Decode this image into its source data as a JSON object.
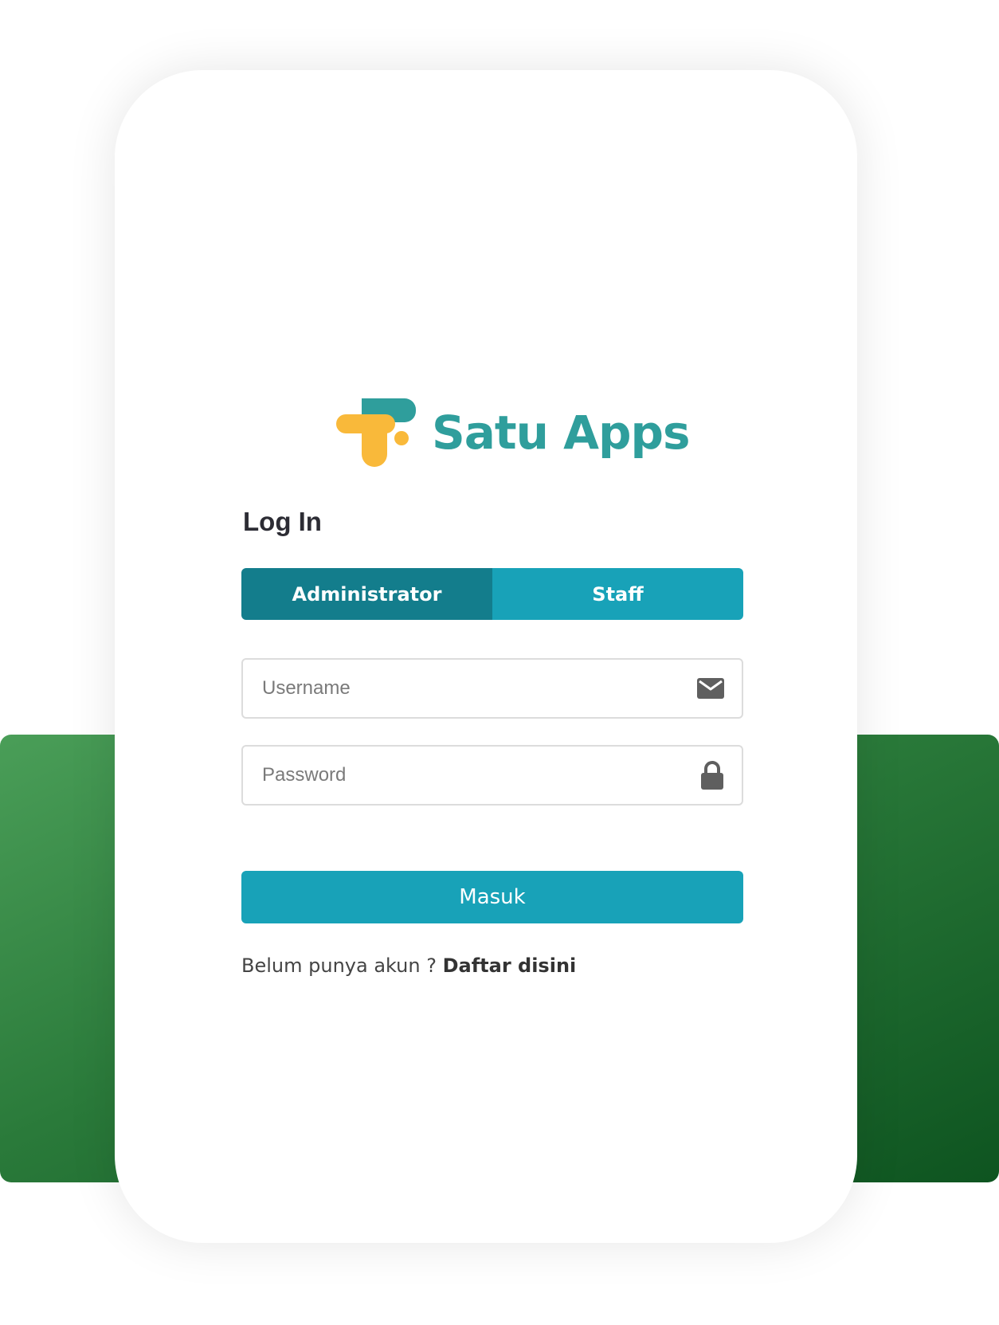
{
  "app": {
    "name": "Satu Apps"
  },
  "login": {
    "title": "Log In",
    "roles": [
      {
        "label": "Administrator",
        "active": true
      },
      {
        "label": "Staff",
        "active": false
      }
    ],
    "username": {
      "placeholder": "Username",
      "value": "",
      "icon": "envelope-icon"
    },
    "password": {
      "placeholder": "Password",
      "value": "",
      "icon": "lock-icon"
    },
    "submit_label": "Masuk",
    "register_prompt": "Belum punya akun ?",
    "register_link": "Daftar disini"
  },
  "colors": {
    "brand_teal": "#2f9e9c",
    "brand_yellow": "#f9b93a",
    "primary": "#18a2b8",
    "primary_dark": "#137d8c",
    "band_green_light": "#4a9e58",
    "band_green_dark": "#0e5420"
  }
}
